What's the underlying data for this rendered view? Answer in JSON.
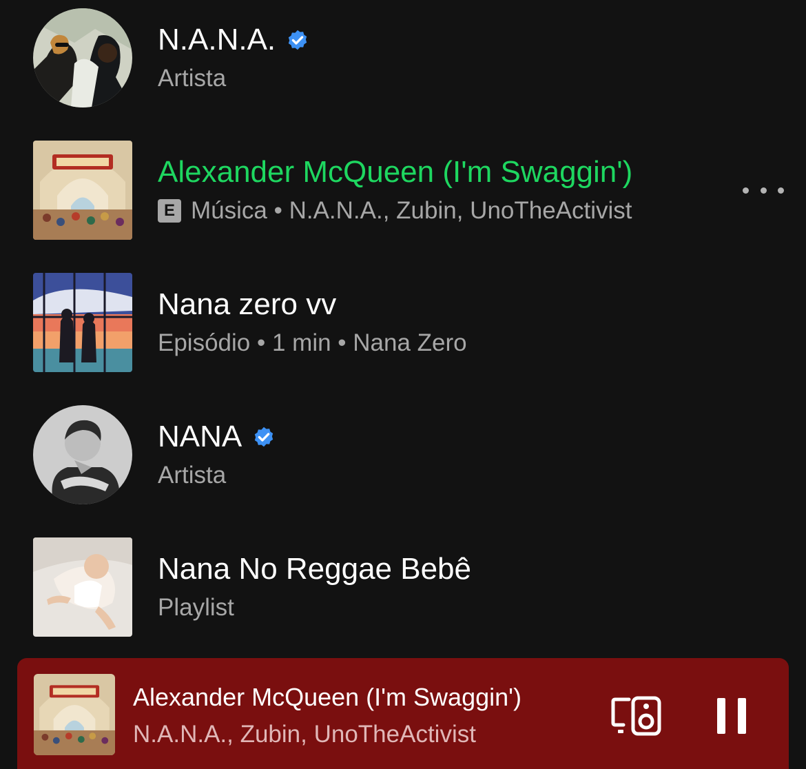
{
  "results": [
    {
      "title": "N.A.N.A.",
      "subtitle": "Artista",
      "verified": true,
      "thumb": "artist-photo-duo",
      "shape": "circle"
    },
    {
      "title": "Alexander McQueen (I'm Swaggin')",
      "explicit_badge": "E",
      "type": "Música",
      "artists": "N.A.N.A., Zubin, UnoTheActivist",
      "separator": " • ",
      "playing": true,
      "thumb": "album-art-school-of-athens",
      "shape": "square"
    },
    {
      "title": "Nana zero vv",
      "type": "Episódio",
      "duration": "1 min",
      "show": "Nana Zero",
      "separator": " • ",
      "thumb": "episode-art-couple-window",
      "shape": "square"
    },
    {
      "title": "NANA",
      "subtitle": "Artista",
      "verified": true,
      "thumb": "artist-photo-bw",
      "shape": "circle"
    },
    {
      "title": "Nana No Reggae Bebê",
      "subtitle": "Playlist",
      "thumb": "playlist-art-baby",
      "shape": "square"
    }
  ],
  "now_playing": {
    "title": "Alexander McQueen (I'm Swaggin')",
    "artists": "N.A.N.A., Zubin, UnoTheActivist",
    "is_playing": true,
    "background_color": "#7a0f0f"
  },
  "colors": {
    "background": "#121212",
    "accent_green": "#1ed760",
    "verified_blue": "#3d91f4",
    "secondary_text": "#a7a7a7"
  },
  "icons": [
    "verified-badge-icon",
    "explicit-badge",
    "more-options-icon",
    "connect-device-icon",
    "pause-icon"
  ]
}
